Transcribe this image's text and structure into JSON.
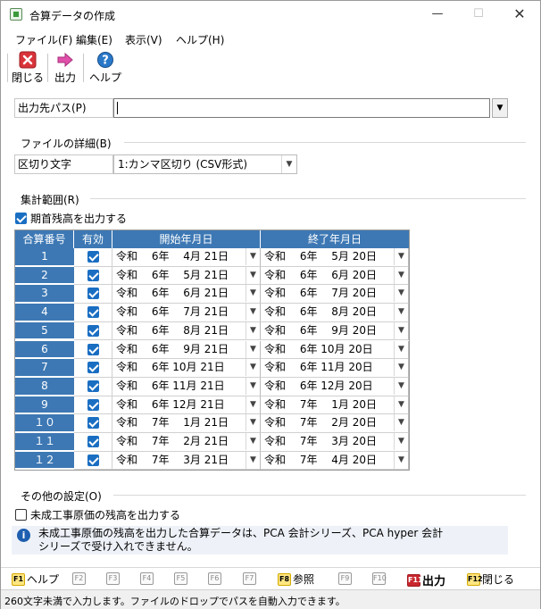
{
  "window": {
    "title": "合算データの作成"
  },
  "menu": [
    {
      "label": "ファイル(F)"
    },
    {
      "label": "編集(E)"
    },
    {
      "label": "表示(V)"
    },
    {
      "label": "ヘルプ(H)"
    }
  ],
  "toolbar": {
    "close_label": "閉じる",
    "output_label": "出力",
    "help_label": "ヘルプ"
  },
  "output_path": {
    "label": "出力先パス(P)",
    "value": ""
  },
  "file_details": {
    "heading": "ファイルの詳細(B)",
    "delimiter_label": "区切り文字",
    "delimiter_value": "1:カンマ区切り (CSV形式)"
  },
  "aggregation": {
    "heading": "集計範囲(R)",
    "opening_balance_label": "期首残高を出力する",
    "opening_balance_checked": true,
    "columns": [
      "合算番号",
      "有効",
      "開始年月日",
      "終了年月日"
    ],
    "rows": [
      {
        "no": "1",
        "enabled": true,
        "start": "令和　 6年　 4月 21日",
        "end": "令和　 6年　 5月 20日"
      },
      {
        "no": "2",
        "enabled": true,
        "start": "令和　 6年　 5月 21日",
        "end": "令和　 6年　 6月 20日"
      },
      {
        "no": "3",
        "enabled": true,
        "start": "令和　 6年　 6月 21日",
        "end": "令和　 6年　 7月 20日"
      },
      {
        "no": "4",
        "enabled": true,
        "start": "令和　 6年　 7月 21日",
        "end": "令和　 6年　 8月 20日"
      },
      {
        "no": "5",
        "enabled": true,
        "start": "令和　 6年　 8月 21日",
        "end": "令和　 6年　 9月 20日"
      },
      {
        "no": "6",
        "enabled": true,
        "start": "令和　 6年　 9月 21日",
        "end": "令和　 6年 10月 20日"
      },
      {
        "no": "7",
        "enabled": true,
        "start": "令和　 6年 10月 21日",
        "end": "令和　 6年 11月 20日"
      },
      {
        "no": "8",
        "enabled": true,
        "start": "令和　 6年 11月 21日",
        "end": "令和　 6年 12月 20日"
      },
      {
        "no": "9",
        "enabled": true,
        "start": "令和　 6年 12月 21日",
        "end": "令和　 7年　 1月 20日"
      },
      {
        "no": "１０",
        "enabled": true,
        "start": "令和　 7年　 1月 21日",
        "end": "令和　 7年　 2月 20日"
      },
      {
        "no": "１１",
        "enabled": true,
        "start": "令和　 7年　 2月 21日",
        "end": "令和　 7年　 3月 20日"
      },
      {
        "no": "１２",
        "enabled": true,
        "start": "令和　 7年　 3月 21日",
        "end": "令和　 7年　 4月 20日"
      }
    ]
  },
  "other_settings": {
    "heading": "その他の設定(O)",
    "wip_label": "未成工事原価の残高を出力する",
    "wip_checked": false
  },
  "info": {
    "line1": "未成工事原価の残高を出力した合算データは、PCA 会計シリーズ、PCA hyper 会計",
    "line2": "シリーズで受け入れできません。"
  },
  "fkeys": [
    {
      "key": "F1",
      "label": "ヘルプ",
      "state": "active"
    },
    {
      "key": "F2",
      "label": "",
      "state": "disabled"
    },
    {
      "key": "F3",
      "label": "",
      "state": "disabled"
    },
    {
      "key": "F4",
      "label": "",
      "state": "disabled"
    },
    {
      "key": "F5",
      "label": "",
      "state": "disabled"
    },
    {
      "key": "F6",
      "label": "",
      "state": "disabled"
    },
    {
      "key": "F7",
      "label": "",
      "state": "disabled"
    },
    {
      "key": "F8",
      "label": "参照",
      "state": "active"
    },
    {
      "key": "F9",
      "label": "",
      "state": "disabled"
    },
    {
      "key": "F10",
      "label": "",
      "state": "disabled"
    },
    {
      "key": "F11",
      "label": "出力",
      "state": "red"
    },
    {
      "key": "F12",
      "label": "閉じる",
      "state": "active"
    }
  ],
  "status": "260文字未満で入力します。ファイルのドロップでパスを自動入力できます。",
  "colors": {
    "grid_header": "#3d78b4",
    "checkbox": "#1a6ec2",
    "info_icon": "#1f5fb0"
  }
}
